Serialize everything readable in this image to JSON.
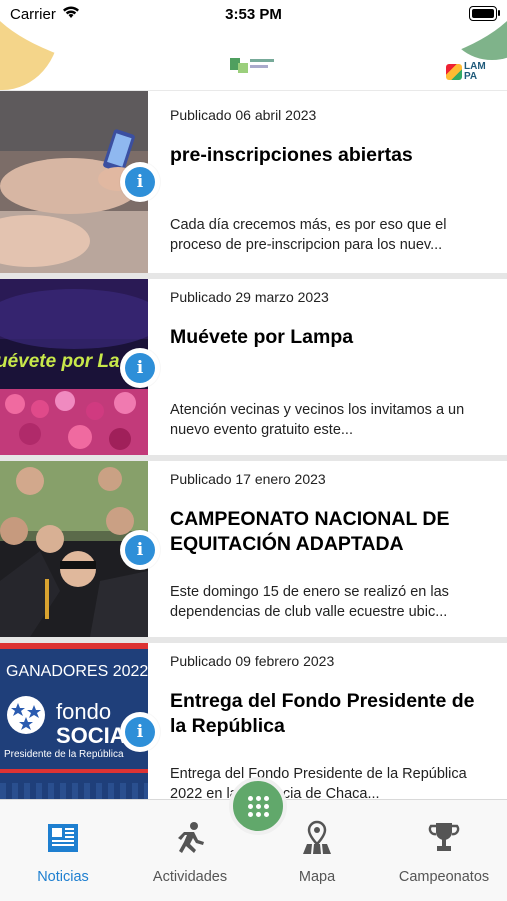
{
  "status": {
    "carrier": "Carrier",
    "time": "3:53 PM"
  },
  "header": {
    "logo_left_alt": "Deporte en Lampa",
    "logo_right_text": "LAMPA"
  },
  "news": [
    {
      "date": "Publicado 06 abril 2023",
      "title": "pre-inscripciones abiertas",
      "excerpt": "Cada día crecemos más, es por eso que el proceso de pre-inscripcion para los nuev..."
    },
    {
      "date": "Publicado 29 marzo 2023",
      "title": "Muévete por Lampa",
      "excerpt": "Atención vecinas y vecinos los invitamos a un nuevo evento gratuito este...",
      "thumb_text": "uévete por La"
    },
    {
      "date": "Publicado 17 enero 2023",
      "title": "CAMPEONATO NACIONAL DE EQUITACIÓN ADAPTADA",
      "excerpt": "Este domingo 15 de enero se realizó en las dependencias de club valle ecuestre ubic..."
    },
    {
      "date": "Publicado 09 febrero 2023",
      "title": "Entrega del Fondo Presidente de la República",
      "excerpt": "Entrega del Fondo Presidente de la República 2022 en la Provincia de Chaca...",
      "thumb_lines": [
        "GANADORES 2022",
        "fondo",
        "SOCIAL",
        "Presidente de la República"
      ]
    }
  ],
  "tabs": [
    {
      "label": "Noticias",
      "icon": "newspaper-icon",
      "active": true
    },
    {
      "label": "Actividades",
      "icon": "runner-icon",
      "active": false
    },
    {
      "label": "Mapa",
      "icon": "map-pin-icon",
      "active": false
    },
    {
      "label": "Campeonatos",
      "icon": "trophy-icon",
      "active": false
    }
  ],
  "colors": {
    "accent": "#1e7fd0",
    "info": "#2e8fd8",
    "fab": "#61a86b"
  }
}
